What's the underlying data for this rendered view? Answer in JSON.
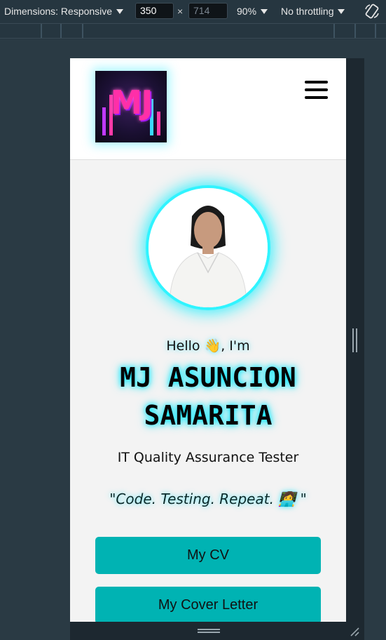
{
  "devtools": {
    "dimensions_label": "Dimensions: Responsive",
    "width_value": "350",
    "height_value": "714",
    "times": "×",
    "zoom": "90%",
    "throttling": "No throttling"
  },
  "site": {
    "logo_text": "MJ",
    "greeting": "Hello 👋, I'm",
    "name_line1": "MJ ASUNCION",
    "name_line2": "SAMARITA",
    "role": "IT Quality Assurance Tester",
    "quote": "\"Code. Testing. Repeat. 👩‍💻 \"",
    "buttons": {
      "cv": "My CV",
      "cover_letter": "My Cover Letter"
    }
  },
  "colors": {
    "accent": "#00b3b3",
    "glow": "#00e8ff"
  }
}
